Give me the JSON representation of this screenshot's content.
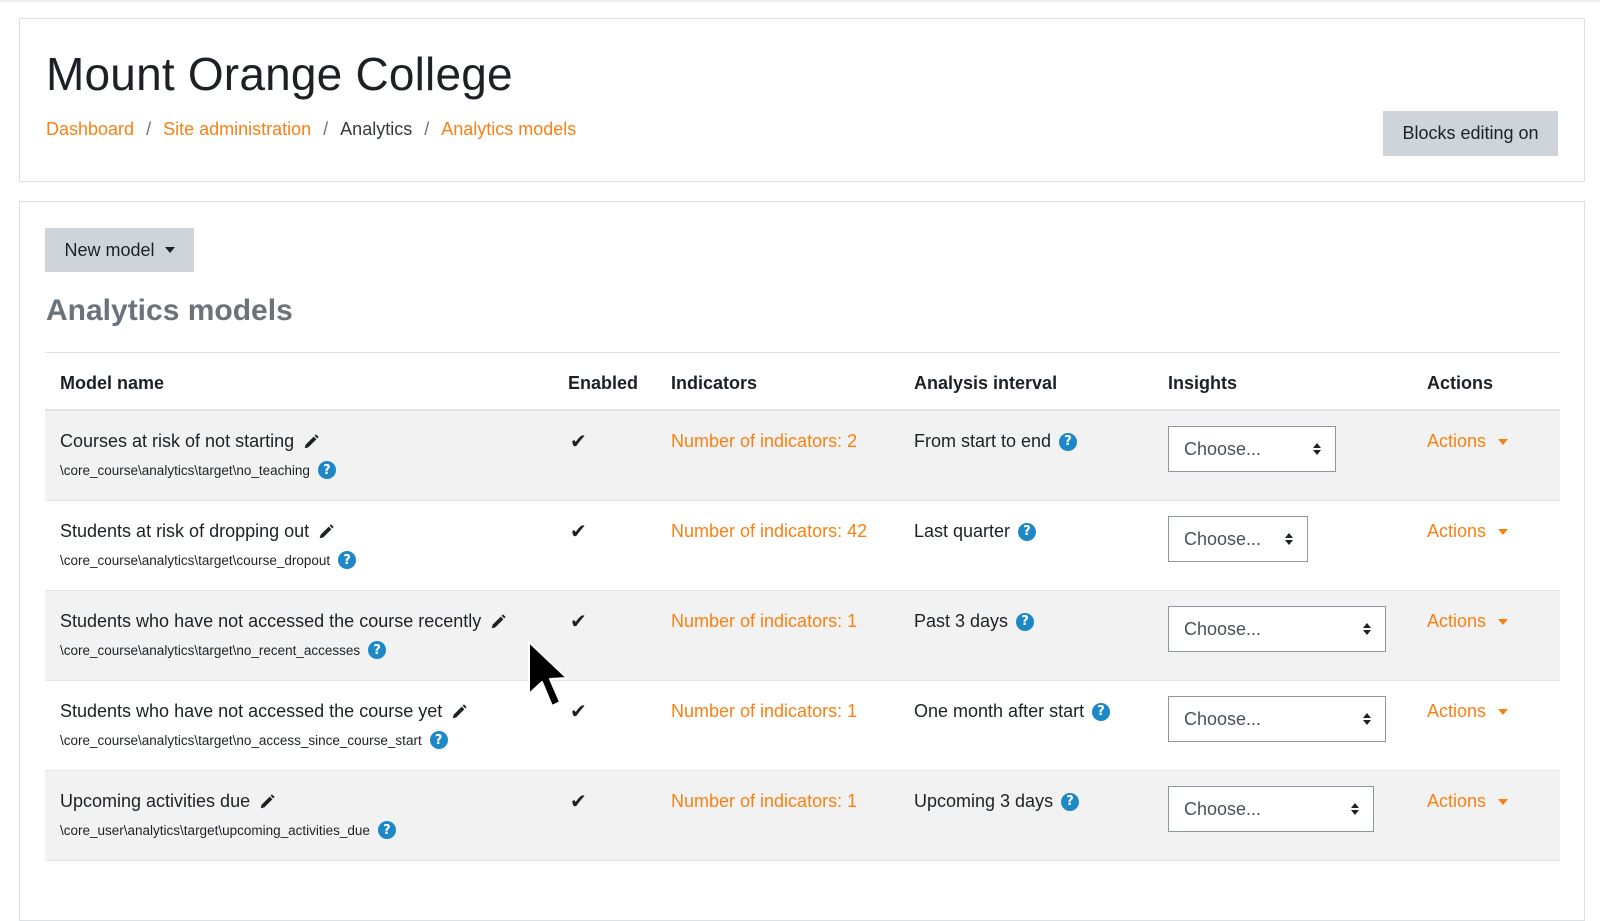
{
  "header": {
    "site_title": "Mount Orange College",
    "breadcrumb": [
      {
        "label": "Dashboard",
        "link": true
      },
      {
        "label": "Site administration",
        "link": true
      },
      {
        "label": "Analytics",
        "link": false
      },
      {
        "label": "Analytics models",
        "link": true
      }
    ],
    "breadcrumb_separator": "/",
    "blocks_editing_label": "Blocks editing on"
  },
  "main": {
    "new_model_label": "New model",
    "section_title": "Analytics models",
    "columns": {
      "model_name": "Model name",
      "enabled": "Enabled",
      "indicators": "Indicators",
      "analysis_interval": "Analysis interval",
      "insights": "Insights",
      "actions": "Actions"
    },
    "rows": [
      {
        "name": "Courses at risk of not starting",
        "target": "\\core_course\\analytics\\target\\no_teaching",
        "enabled": "✔",
        "indicators": "Number of indicators: 2",
        "interval": "From start to end",
        "insights": "Choose...",
        "actions": "Actions"
      },
      {
        "name": "Students at risk of dropping out",
        "target": "\\core_course\\analytics\\target\\course_dropout",
        "enabled": "✔",
        "indicators": "Number of indicators: 42",
        "interval": "Last quarter",
        "insights": "Choose...",
        "actions": "Actions"
      },
      {
        "name": "Students who have not accessed the course recently",
        "target": "\\core_course\\analytics\\target\\no_recent_accesses",
        "enabled": "✔",
        "indicators": "Number of indicators: 1",
        "interval": "Past 3 days",
        "insights": "Choose...",
        "actions": "Actions"
      },
      {
        "name": "Students who have not accessed the course yet",
        "target": "\\core_course\\analytics\\target\\no_access_since_course_start",
        "enabled": "✔",
        "indicators": "Number of indicators: 1",
        "interval": "One month after start",
        "insights": "Choose...",
        "actions": "Actions"
      },
      {
        "name": "Upcoming activities due",
        "target": "\\core_user\\analytics\\target\\upcoming_activities_due",
        "enabled": "✔",
        "indicators": "Number of indicators: 1",
        "interval": "Upcoming 3 days",
        "insights": "Choose...",
        "actions": "Actions"
      }
    ]
  },
  "icons": {
    "edit": "pencil-icon",
    "help": "question-circle-icon",
    "enabled": "check-icon",
    "dropdown": "caret-down-icon",
    "select": "sort-arrows-icon",
    "cursor": "mouse-pointer-icon"
  },
  "colors": {
    "accent": "#f98012",
    "help_icon": "#1e88c7",
    "button_bg": "#ced4da",
    "muted_heading": "#6a737b",
    "stripe": "#f2f2f2"
  }
}
